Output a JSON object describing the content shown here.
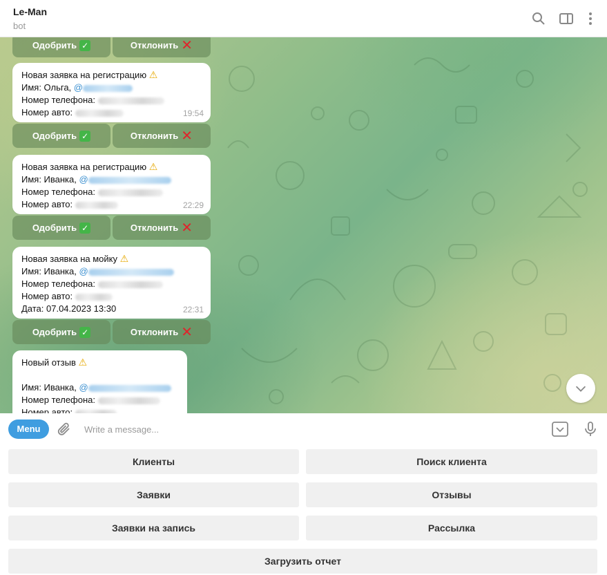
{
  "header": {
    "title": "Le-Man",
    "subtitle": "bot",
    "icons": [
      "search-icon",
      "sidebar-toggle-icon",
      "more-vertical-icon"
    ]
  },
  "chat": {
    "approve_label": "Одобрить",
    "reject_label": "Отклонить",
    "messages": [
      {
        "title": "Новая заявка на регистрацию",
        "name_label": "Имя: Ольга,",
        "mention_visible": "@",
        "phone_label": "Номер телефона:",
        "car_label": "Номер авто:",
        "time": "19:54"
      },
      {
        "title": "Новая заявка на регистрацию",
        "name_label": "Имя: Иванка,",
        "mention_visible": "@",
        "phone_label": "Номер телефона:",
        "car_label": "Номер авто:",
        "time": "22:29"
      },
      {
        "title": "Новая заявка на мойку",
        "name_label": "Имя: Иванка,",
        "mention_visible": "@",
        "phone_label": "Номер телефона:",
        "car_label": "Номер авто:",
        "date_label": "Дата: 07.04.2023 13:30",
        "time": "22:31"
      },
      {
        "title": "Новый отзыв",
        "name_label": "Имя: Иванка,",
        "mention_visible": "@",
        "phone_label": "Номер телефона:",
        "car_label": "Номер авто:"
      }
    ]
  },
  "composer": {
    "menu_label": "Menu",
    "placeholder": "Write a message..."
  },
  "keyboard": {
    "rows": [
      [
        "Клиенты",
        "Поиск клиента"
      ],
      [
        "Заявки",
        "Отзывы"
      ],
      [
        "Заявки на запись",
        "Рассылка"
      ],
      [
        "Загрузить отчет"
      ]
    ]
  },
  "colors": {
    "accent": "#3f9de0",
    "inline_button_bg": "#668858",
    "check_green": "#44b548",
    "cross_red": "#e0242b",
    "warning_yellow": "#e6a800"
  }
}
